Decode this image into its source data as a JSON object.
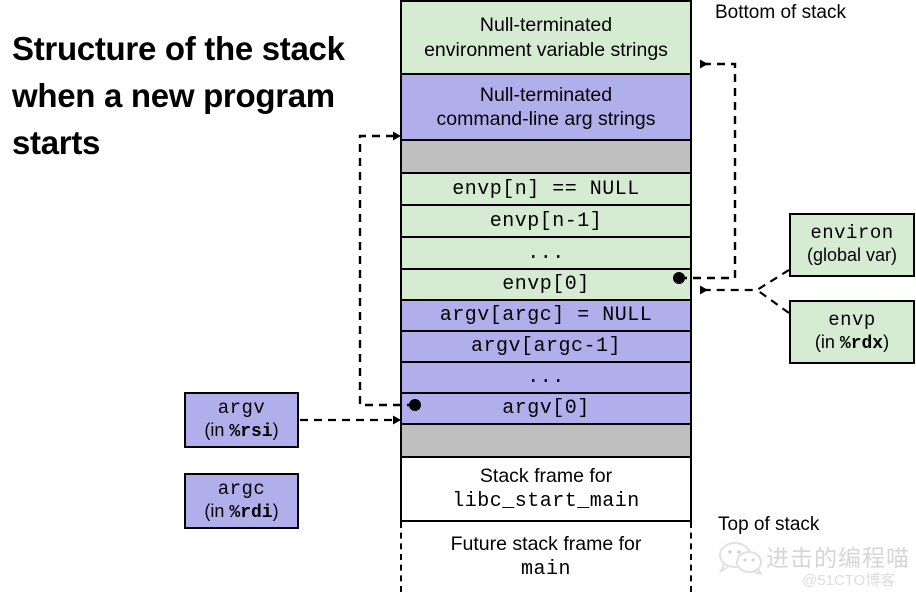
{
  "title": "Structure of the stack when a new program starts",
  "labels": {
    "bottom_of_stack": "Bottom of stack",
    "top_of_stack": "Top of stack"
  },
  "stack_rows": [
    {
      "id": "env-strings",
      "line1": "Null-terminated",
      "line2": "environment variable strings",
      "fill": "green",
      "font": "sans"
    },
    {
      "id": "arg-strings",
      "line1": "Null-terminated",
      "line2": "command-line arg strings",
      "fill": "purple",
      "font": "sans"
    },
    {
      "id": "pad-top",
      "line1": "",
      "line2": "",
      "fill": "gray",
      "font": "sans"
    },
    {
      "id": "envp-null",
      "line1": "envp[n] == NULL",
      "line2": "",
      "fill": "green",
      "font": "mono"
    },
    {
      "id": "envp-n-1",
      "line1": "envp[n-1]",
      "line2": "",
      "fill": "green",
      "font": "mono"
    },
    {
      "id": "envp-ellipsis",
      "line1": "...",
      "line2": "",
      "fill": "green",
      "font": "mono"
    },
    {
      "id": "envp-0",
      "line1": "envp[0]",
      "line2": "",
      "fill": "green",
      "font": "mono"
    },
    {
      "id": "argv-null",
      "line1": "argv[argc] = NULL",
      "line2": "",
      "fill": "purple",
      "font": "mono"
    },
    {
      "id": "argv-argc-1",
      "line1": "argv[argc-1]",
      "line2": "",
      "fill": "purple",
      "font": "mono"
    },
    {
      "id": "argv-ellipsis",
      "line1": "...",
      "line2": "",
      "fill": "purple",
      "font": "mono"
    },
    {
      "id": "argv-0",
      "line1": "argv[0]",
      "line2": "",
      "fill": "purple",
      "font": "mono"
    },
    {
      "id": "pad-bottom",
      "line1": "",
      "line2": "",
      "fill": "gray",
      "font": "sans"
    },
    {
      "id": "libc-frame",
      "line1": "Stack frame for",
      "line2": "libc_start_main",
      "fill": "white",
      "font": "mixed"
    },
    {
      "id": "main-frame",
      "line1": "Future stack frame for",
      "line2": "main",
      "fill": "white",
      "font": "mixed"
    }
  ],
  "callouts": {
    "environ": {
      "name": "environ",
      "sub_prefix": "(global var",
      "sub_reg": "",
      "sub_suffix": ")"
    },
    "envp": {
      "name": "envp",
      "sub_prefix": "(in ",
      "sub_reg": "%rdx",
      "sub_suffix": ")"
    },
    "argv": {
      "name": "argv",
      "sub_prefix": "(in ",
      "sub_reg": "%rsi",
      "sub_suffix": ")"
    },
    "argc": {
      "name": "argc",
      "sub_prefix": "(in ",
      "sub_reg": "%rdi",
      "sub_suffix": ")"
    }
  },
  "watermark": {
    "text": "进击的编程喵",
    "subtext": "@51CTO博客"
  },
  "colors": {
    "green": "#d6ecd2",
    "purple": "#b1afeb",
    "gray": "#bfbfbf",
    "border": "#000000"
  }
}
